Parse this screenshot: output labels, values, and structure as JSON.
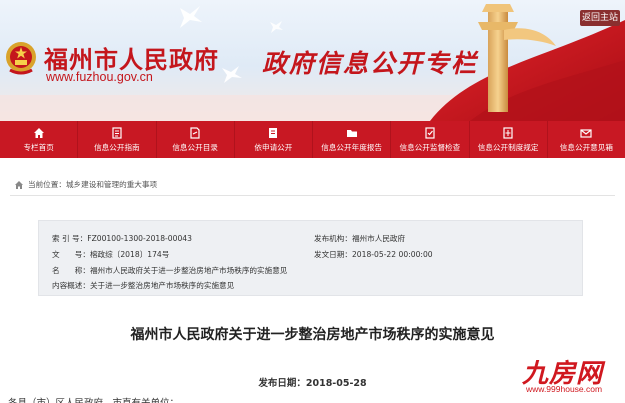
{
  "banner": {
    "site_title": "福州市人民政府",
    "site_url": "www.fuzhou.gov.cn",
    "slogan": "政府信息公开专栏",
    "back_home": "返回主站"
  },
  "nav": {
    "items": [
      {
        "label": "专栏首页",
        "icon": "home-icon"
      },
      {
        "label": "信息公开指南",
        "icon": "guide-book-icon"
      },
      {
        "label": "信息公开目录",
        "icon": "catalog-icon"
      },
      {
        "label": "依申请公开",
        "icon": "document-icon"
      },
      {
        "label": "信息公开年度报告",
        "icon": "folder-icon"
      },
      {
        "label": "信息公开监督检查",
        "icon": "inspection-icon"
      },
      {
        "label": "信息公开制度规定",
        "icon": "regulation-icon"
      },
      {
        "label": "信息公开意见箱",
        "icon": "mailbox-icon"
      }
    ]
  },
  "breadcrumb": {
    "prefix": "当前位置：",
    "path": "城乡建设和管理的重大事项"
  },
  "meta": {
    "index_label": "索 引 号：",
    "index_value": "FZ00100-1300-2018-00043",
    "issuer_label": "发布机构：",
    "issuer_value": "福州市人民政府",
    "docno_label": "文　　号：",
    "docno_value": "榕政综〔2018〕174号",
    "date_label": "发文日期：",
    "date_value": "2018-05-22 00:00:00",
    "name_label": "名　　称：",
    "name_value": "福州市人民政府关于进一步整治房地产市场秩序的实施意见",
    "summary_label": "内容概述：",
    "summary_value": "关于进一步整治房地产市场秩序的实施意见"
  },
  "article": {
    "title": "福州市人民政府关于进一步整治房地产市场秩序的实施意见",
    "pub_date": "发布日期：2018-05-28",
    "first_line": "各县（市）区人民政府，市直有关单位："
  },
  "watermark": {
    "brand": "九房网",
    "url": "www.999house.com"
  },
  "colors": {
    "brand_red": "#c81823",
    "meta_bg": "#eef0f3"
  }
}
